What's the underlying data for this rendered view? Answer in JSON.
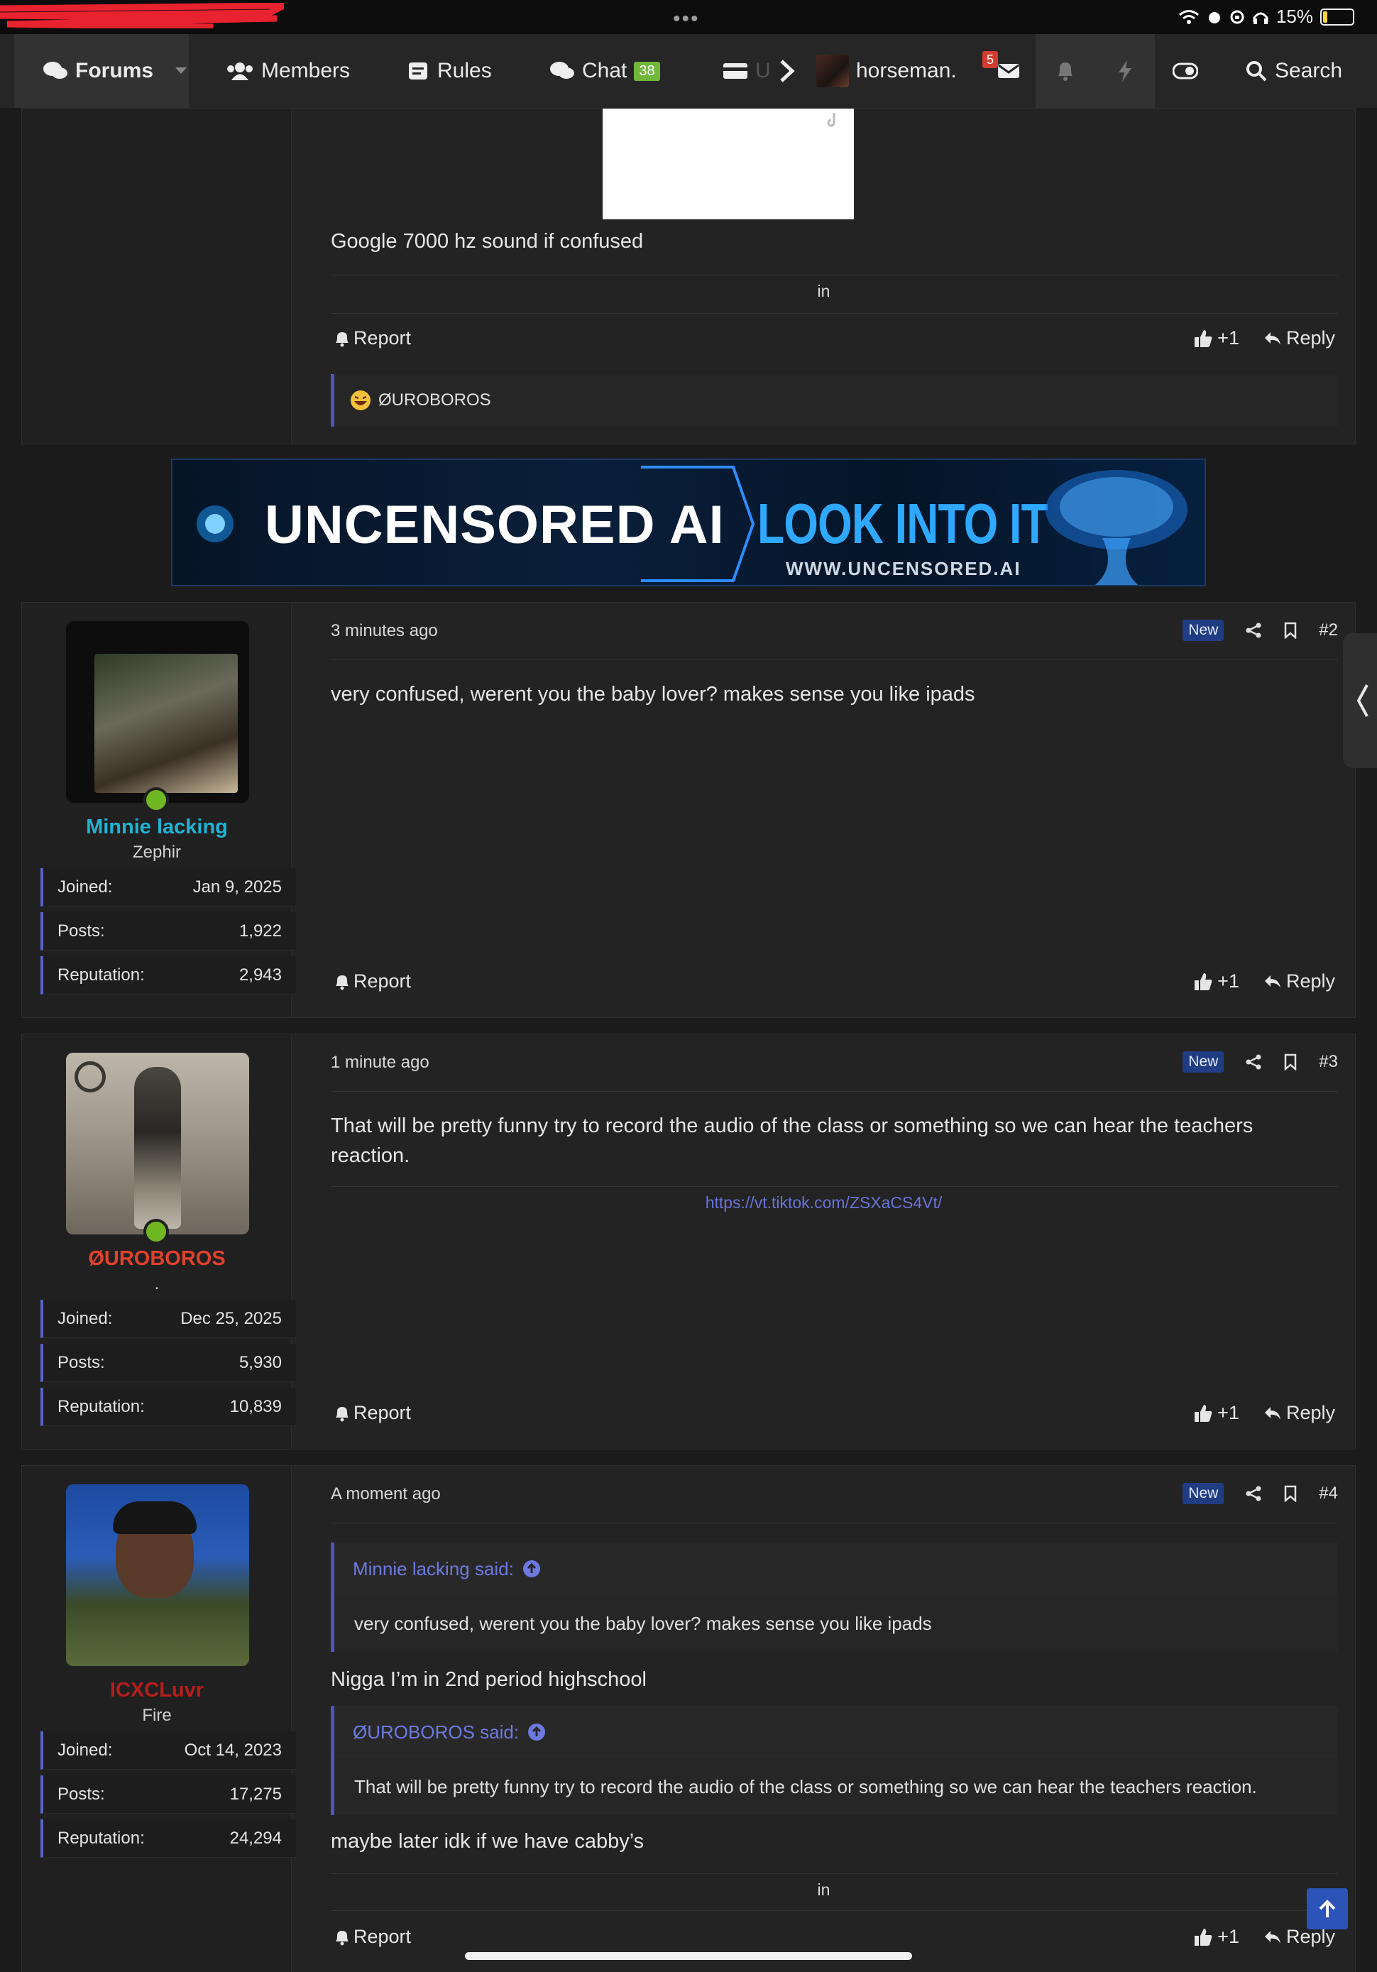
{
  "status_bar": {
    "battery": "15%",
    "battery_level": 0.15
  },
  "nav": {
    "forums": "Forums",
    "members": "Members",
    "rules": "Rules",
    "chat": "Chat",
    "chat_count": "38",
    "truncated_item": "U",
    "user": "horseman.",
    "inbox_count": "5",
    "search": "Search"
  },
  "post1": {
    "text": "Google 7000 hz sound if confused",
    "in_label": "in",
    "report": "Report",
    "like": "+1",
    "reply": "Reply",
    "reaction_user": "ØUROBOROS"
  },
  "banner": {
    "left_text": "UNCENSORED AI",
    "right_text": "LOOK INTO IT",
    "url": "WWW.UNCENSORED.AI"
  },
  "posts": [
    {
      "username": "Minnie lacking",
      "username_color": "#1fb3d4",
      "title": "Zephir",
      "joined_label": "Joined:",
      "joined": "Jan 9, 2025",
      "posts_label": "Posts:",
      "posts": "1,922",
      "rep_label": "Reputation:",
      "rep": "2,943",
      "time": "3 minutes ago",
      "new": "New",
      "num": "#2",
      "text": "very confused, werent you the baby lover? makes sense you like ipads",
      "report": "Report",
      "like": "+1",
      "reply": "Reply"
    },
    {
      "username": "ØUROBOROS",
      "username_color": "#e0412d",
      "title": ".",
      "joined_label": "Joined:",
      "joined": "Dec 25, 2025",
      "posts_label": "Posts:",
      "posts": "5,930",
      "rep_label": "Reputation:",
      "rep": "10,839",
      "time": "1 minute ago",
      "new": "New",
      "num": "#3",
      "text": "That will be pretty funny try to record the audio of the class or something so we can hear the teachers reaction.",
      "link": "https://vt.tiktok.com/ZSXaCS4Vt/",
      "report": "Report",
      "like": "+1",
      "reply": "Reply"
    },
    {
      "username": "ICXCLuvr",
      "username_color": "#b51d1d",
      "title": "Fire",
      "joined_label": "Joined:",
      "joined": "Oct 14, 2023",
      "posts_label": "Posts:",
      "posts": "17,275",
      "rep_label": "Reputation:",
      "rep": "24,294",
      "time": "A moment ago",
      "new": "New",
      "num": "#4",
      "quote1_author": "Minnie lacking said:",
      "quote1_text": "very confused, werent you the baby lover? makes sense you like ipads",
      "reply1": "Nigga I’m in 2nd period highschool",
      "quote2_author": "ØUROBOROS said:",
      "quote2_text": "That will be pretty funny try to record the audio of the class or something so we can hear the teachers reaction.",
      "reply2": "maybe later idk if we have cabby’s",
      "in_label": "in",
      "report": "Report",
      "like": "+1",
      "reply": "Reply"
    }
  ]
}
